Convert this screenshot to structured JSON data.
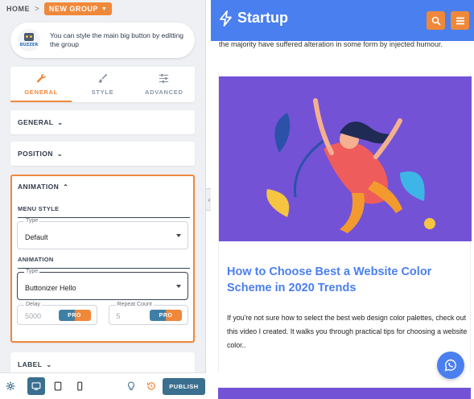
{
  "breadcrumb": {
    "home": "HOME",
    "separator": ">",
    "group_label": "NEW GROUP",
    "group_caret_icon": "caret-down-icon"
  },
  "info_card": {
    "logo_text": "BUZZER",
    "text": "You can style the main big button by editting the group"
  },
  "tabs": [
    {
      "label": "GENERAL",
      "icon": "wrench-icon",
      "active": true
    },
    {
      "label": "STYLE",
      "icon": "brush-icon",
      "active": false
    },
    {
      "label": "ADVANCED",
      "icon": "sliders-icon",
      "active": false
    }
  ],
  "sections": {
    "general": "GENERAL",
    "position": "POSITION",
    "animation": "ANIMATION",
    "label": "LABEL"
  },
  "animation_panel": {
    "menu_style_heading": "MENU STYLE",
    "menu_style_legend": "Type",
    "menu_style_value": "Default",
    "animation_heading": "ANIMATION",
    "animation_legend": "Type",
    "animation_value": "Buttonizer Hello",
    "delay_legend": "Delay",
    "delay_value": "5000",
    "repeat_legend": "Repeat Count",
    "repeat_value": "5",
    "pro_badge": "PRO"
  },
  "bottom_bar": {
    "publish_label": "PUBLISH",
    "icons": [
      "gear-icon",
      "desktop-icon",
      "tablet-icon",
      "mobile-icon",
      "lightbulb-icon",
      "history-icon"
    ]
  },
  "preview": {
    "brand": "Startup",
    "cut_text": "the majority have suffered alteration in some form by injected humour.",
    "post_title": "How to Choose Best a Website Color Scheme in 2020 Trends",
    "post_excerpt": "If you're not sure how to select the best web design color palettes, check out this video I created. It walks you through practical tips for choosing a website color..",
    "colors": {
      "header": "#4a7ff0",
      "accent": "#f0883a",
      "image_bg": "#7352d6"
    }
  }
}
